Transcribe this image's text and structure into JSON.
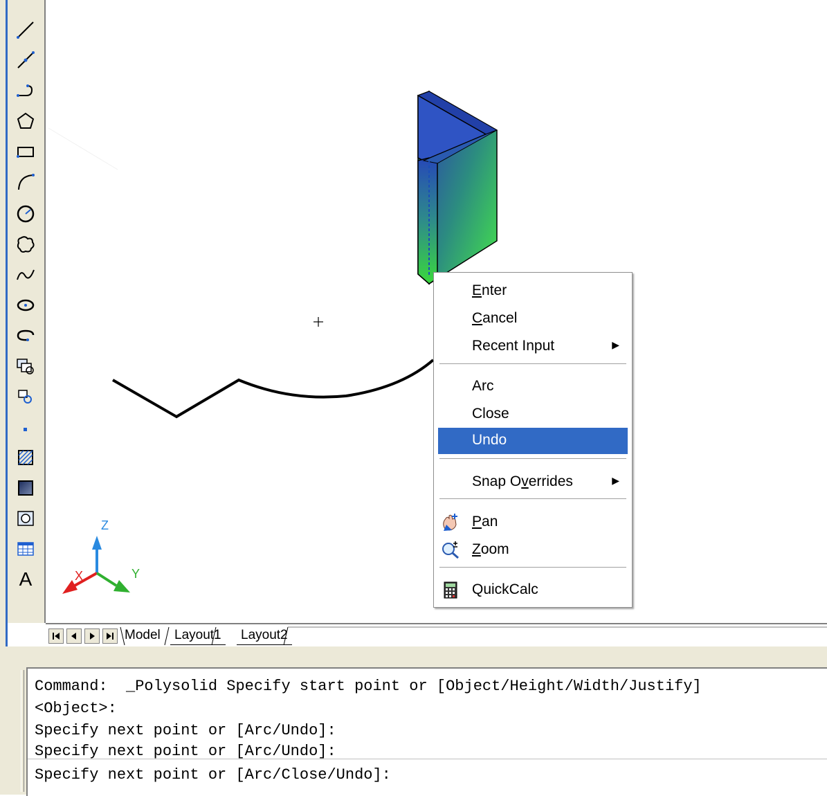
{
  "toolbar": {
    "tools": [
      {
        "name": "line-icon"
      },
      {
        "name": "construction-line-icon"
      },
      {
        "name": "polyline-icon"
      },
      {
        "name": "polygon-icon"
      },
      {
        "name": "rectangle-icon"
      },
      {
        "name": "arc-icon"
      },
      {
        "name": "circle-icon"
      },
      {
        "name": "revision-cloud-icon"
      },
      {
        "name": "spline-icon"
      },
      {
        "name": "ellipse-icon"
      },
      {
        "name": "ellipse-arc-icon"
      },
      {
        "name": "insert-block-icon"
      },
      {
        "name": "make-block-icon"
      },
      {
        "name": "point-icon"
      },
      {
        "name": "hatch-icon"
      },
      {
        "name": "gradient-icon"
      },
      {
        "name": "region-icon"
      },
      {
        "name": "table-icon"
      },
      {
        "name": "multiline-text-icon"
      }
    ],
    "text_tool_label": "A"
  },
  "ucs": {
    "x_label": "X",
    "y_label": "Y",
    "z_label": "Z"
  },
  "tabs": {
    "items": [
      {
        "label": "Model",
        "active": true
      },
      {
        "label": "Layout1",
        "active": false
      },
      {
        "label": "Layout2",
        "active": false
      }
    ]
  },
  "context_menu": {
    "enter": {
      "prefix": "",
      "accel": "E",
      "rest": "nter"
    },
    "cancel": {
      "prefix": "",
      "accel": "C",
      "rest": "ancel"
    },
    "recent_input": "Recent Input",
    "arc": "Arc",
    "close": "Close",
    "undo": "Undo",
    "snap_overrides": {
      "prefix": "Snap O",
      "accel": "v",
      "rest": "errides"
    },
    "pan": {
      "prefix": "",
      "accel": "P",
      "rest": "an"
    },
    "zoom": {
      "prefix": "",
      "accel": "Z",
      "rest": "oom"
    },
    "quickcalc": "QuickCalc",
    "submenu_arrow": "▶"
  },
  "command": {
    "lines": [
      "Command:  _Polysolid Specify start point or [Object/Height/Width/Justify]",
      "<Object>:",
      "Specify next point or [Arc/Undo]:",
      "Specify next point or [Arc/Undo]:"
    ],
    "prompt": "Specify next point or [Arc/Close/Undo]:"
  },
  "colors": {
    "highlight": "#316ac5",
    "solid_top": "#2a4fb8",
    "solid_bottom": "#35d43a",
    "ucs_x": "#e02020",
    "ucs_y": "#30b030",
    "ucs_z": "#2a8ae0"
  }
}
